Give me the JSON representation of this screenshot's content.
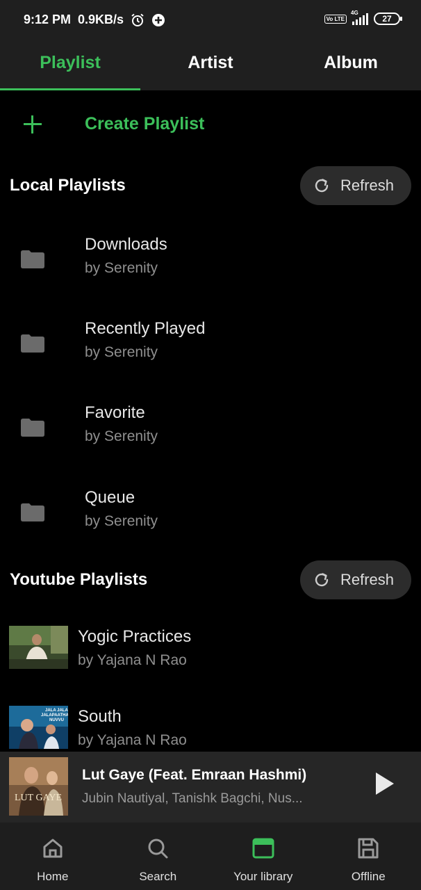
{
  "status_bar": {
    "time": "9:12 PM",
    "net_speed": "0.9KB/s",
    "network": "4G",
    "volte": "Vo LTE",
    "battery": "27"
  },
  "tabs": [
    {
      "label": "Playlist",
      "active": true
    },
    {
      "label": "Artist",
      "active": false
    },
    {
      "label": "Album",
      "active": false
    }
  ],
  "create": {
    "label": "Create Playlist"
  },
  "local": {
    "title": "Local Playlists",
    "refresh_label": "Refresh",
    "items": [
      {
        "title": "Downloads",
        "subtitle": "by Serenity"
      },
      {
        "title": "Recently Played",
        "subtitle": "by Serenity"
      },
      {
        "title": "Favorite",
        "subtitle": "by Serenity"
      },
      {
        "title": "Queue",
        "subtitle": "by Serenity"
      }
    ]
  },
  "youtube": {
    "title": "Youtube Playlists",
    "refresh_label": "Refresh",
    "items": [
      {
        "title": "Yogic Practices",
        "subtitle": "by Yajana N Rao"
      },
      {
        "title": "South",
        "subtitle": "by Yajana N Rao",
        "thumb_text": "JALA JALA JALAPAATHAM NUVVU"
      }
    ]
  },
  "now_playing": {
    "title": "Lut Gaye (Feat. Emraan Hashmi)",
    "artist": "Jubin Nautiyal, Tanishk Bagchi, Nus...",
    "art_text": "LUT GAYE"
  },
  "nav": [
    {
      "label": "Home",
      "icon": "home-icon",
      "active": false
    },
    {
      "label": "Search",
      "icon": "search-icon",
      "active": false
    },
    {
      "label": "Your library",
      "icon": "library-icon",
      "active": true
    },
    {
      "label": "Offline",
      "icon": "save-icon",
      "active": false
    }
  ],
  "colors": {
    "accent": "#3cbf5a",
    "background": "#000000",
    "bar": "#1f1f1f",
    "pill": "#2c2c2c"
  }
}
